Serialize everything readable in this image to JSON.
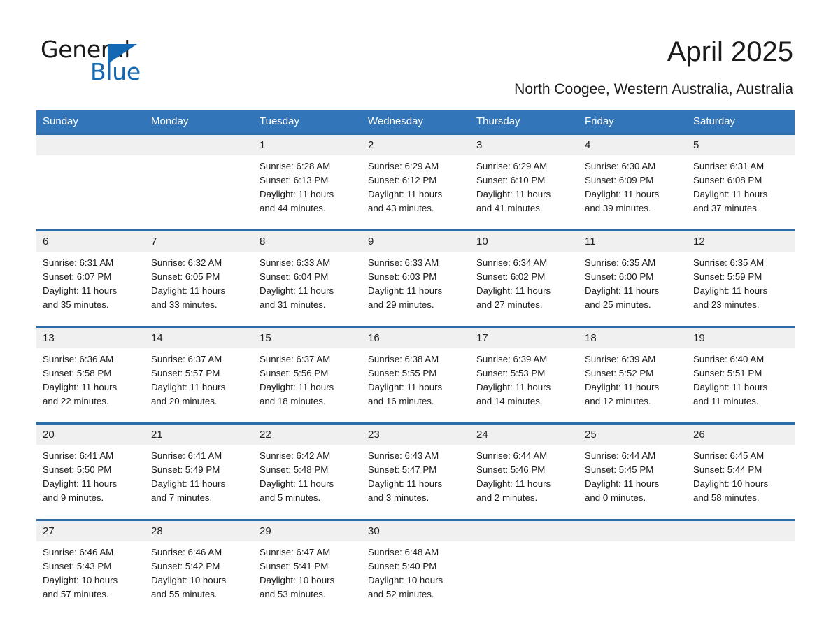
{
  "brand": {
    "name_part1": "General",
    "name_part2": "Blue",
    "triangle_color": "#1268b3"
  },
  "header": {
    "month_title": "April 2025",
    "location": "North Coogee, Western Australia, Australia"
  },
  "theme": {
    "header_blue": "#3275b8",
    "separator_blue": "#2d6ca8",
    "daynum_band": "#f0f0f0"
  },
  "calendar": {
    "weekday_headers": [
      "Sunday",
      "Monday",
      "Tuesday",
      "Wednesday",
      "Thursday",
      "Friday",
      "Saturday"
    ],
    "weeks": [
      [
        {
          "day": "",
          "lines": []
        },
        {
          "day": "",
          "lines": []
        },
        {
          "day": "1",
          "lines": [
            "Sunrise: 6:28 AM",
            "Sunset: 6:13 PM",
            "Daylight: 11 hours",
            "and 44 minutes."
          ]
        },
        {
          "day": "2",
          "lines": [
            "Sunrise: 6:29 AM",
            "Sunset: 6:12 PM",
            "Daylight: 11 hours",
            "and 43 minutes."
          ]
        },
        {
          "day": "3",
          "lines": [
            "Sunrise: 6:29 AM",
            "Sunset: 6:10 PM",
            "Daylight: 11 hours",
            "and 41 minutes."
          ]
        },
        {
          "day": "4",
          "lines": [
            "Sunrise: 6:30 AM",
            "Sunset: 6:09 PM",
            "Daylight: 11 hours",
            "and 39 minutes."
          ]
        },
        {
          "day": "5",
          "lines": [
            "Sunrise: 6:31 AM",
            "Sunset: 6:08 PM",
            "Daylight: 11 hours",
            "and 37 minutes."
          ]
        }
      ],
      [
        {
          "day": "6",
          "lines": [
            "Sunrise: 6:31 AM",
            "Sunset: 6:07 PM",
            "Daylight: 11 hours",
            "and 35 minutes."
          ]
        },
        {
          "day": "7",
          "lines": [
            "Sunrise: 6:32 AM",
            "Sunset: 6:05 PM",
            "Daylight: 11 hours",
            "and 33 minutes."
          ]
        },
        {
          "day": "8",
          "lines": [
            "Sunrise: 6:33 AM",
            "Sunset: 6:04 PM",
            "Daylight: 11 hours",
            "and 31 minutes."
          ]
        },
        {
          "day": "9",
          "lines": [
            "Sunrise: 6:33 AM",
            "Sunset: 6:03 PM",
            "Daylight: 11 hours",
            "and 29 minutes."
          ]
        },
        {
          "day": "10",
          "lines": [
            "Sunrise: 6:34 AM",
            "Sunset: 6:02 PM",
            "Daylight: 11 hours",
            "and 27 minutes."
          ]
        },
        {
          "day": "11",
          "lines": [
            "Sunrise: 6:35 AM",
            "Sunset: 6:00 PM",
            "Daylight: 11 hours",
            "and 25 minutes."
          ]
        },
        {
          "day": "12",
          "lines": [
            "Sunrise: 6:35 AM",
            "Sunset: 5:59 PM",
            "Daylight: 11 hours",
            "and 23 minutes."
          ]
        }
      ],
      [
        {
          "day": "13",
          "lines": [
            "Sunrise: 6:36 AM",
            "Sunset: 5:58 PM",
            "Daylight: 11 hours",
            "and 22 minutes."
          ]
        },
        {
          "day": "14",
          "lines": [
            "Sunrise: 6:37 AM",
            "Sunset: 5:57 PM",
            "Daylight: 11 hours",
            "and 20 minutes."
          ]
        },
        {
          "day": "15",
          "lines": [
            "Sunrise: 6:37 AM",
            "Sunset: 5:56 PM",
            "Daylight: 11 hours",
            "and 18 minutes."
          ]
        },
        {
          "day": "16",
          "lines": [
            "Sunrise: 6:38 AM",
            "Sunset: 5:55 PM",
            "Daylight: 11 hours",
            "and 16 minutes."
          ]
        },
        {
          "day": "17",
          "lines": [
            "Sunrise: 6:39 AM",
            "Sunset: 5:53 PM",
            "Daylight: 11 hours",
            "and 14 minutes."
          ]
        },
        {
          "day": "18",
          "lines": [
            "Sunrise: 6:39 AM",
            "Sunset: 5:52 PM",
            "Daylight: 11 hours",
            "and 12 minutes."
          ]
        },
        {
          "day": "19",
          "lines": [
            "Sunrise: 6:40 AM",
            "Sunset: 5:51 PM",
            "Daylight: 11 hours",
            "and 11 minutes."
          ]
        }
      ],
      [
        {
          "day": "20",
          "lines": [
            "Sunrise: 6:41 AM",
            "Sunset: 5:50 PM",
            "Daylight: 11 hours",
            "and 9 minutes."
          ]
        },
        {
          "day": "21",
          "lines": [
            "Sunrise: 6:41 AM",
            "Sunset: 5:49 PM",
            "Daylight: 11 hours",
            "and 7 minutes."
          ]
        },
        {
          "day": "22",
          "lines": [
            "Sunrise: 6:42 AM",
            "Sunset: 5:48 PM",
            "Daylight: 11 hours",
            "and 5 minutes."
          ]
        },
        {
          "day": "23",
          "lines": [
            "Sunrise: 6:43 AM",
            "Sunset: 5:47 PM",
            "Daylight: 11 hours",
            "and 3 minutes."
          ]
        },
        {
          "day": "24",
          "lines": [
            "Sunrise: 6:44 AM",
            "Sunset: 5:46 PM",
            "Daylight: 11 hours",
            "and 2 minutes."
          ]
        },
        {
          "day": "25",
          "lines": [
            "Sunrise: 6:44 AM",
            "Sunset: 5:45 PM",
            "Daylight: 11 hours",
            "and 0 minutes."
          ]
        },
        {
          "day": "26",
          "lines": [
            "Sunrise: 6:45 AM",
            "Sunset: 5:44 PM",
            "Daylight: 10 hours",
            "and 58 minutes."
          ]
        }
      ],
      [
        {
          "day": "27",
          "lines": [
            "Sunrise: 6:46 AM",
            "Sunset: 5:43 PM",
            "Daylight: 10 hours",
            "and 57 minutes."
          ]
        },
        {
          "day": "28",
          "lines": [
            "Sunrise: 6:46 AM",
            "Sunset: 5:42 PM",
            "Daylight: 10 hours",
            "and 55 minutes."
          ]
        },
        {
          "day": "29",
          "lines": [
            "Sunrise: 6:47 AM",
            "Sunset: 5:41 PM",
            "Daylight: 10 hours",
            "and 53 minutes."
          ]
        },
        {
          "day": "30",
          "lines": [
            "Sunrise: 6:48 AM",
            "Sunset: 5:40 PM",
            "Daylight: 10 hours",
            "and 52 minutes."
          ]
        },
        {
          "day": "",
          "lines": []
        },
        {
          "day": "",
          "lines": []
        },
        {
          "day": "",
          "lines": []
        }
      ]
    ]
  }
}
